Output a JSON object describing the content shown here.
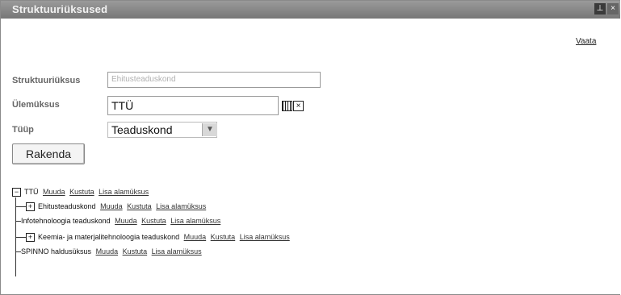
{
  "window": {
    "title": "Struktuuriüksused"
  },
  "top_link": "Vaata",
  "form": {
    "unit_label": "Struktuuriüksus",
    "unit_value": "Ehitusteaduskond",
    "parent_label": "Ülemüksus",
    "parent_value": "TTÜ",
    "type_label": "Tüüp",
    "type_value": "Teaduskond",
    "apply_label": "Rakenda"
  },
  "tree": {
    "root": {
      "label": "TTÜ",
      "actions": [
        "Muuda",
        "Kustuta",
        "Lisa alamüksus"
      ]
    },
    "children": [
      {
        "label": "Ehitusteaduskond",
        "expandable": true,
        "actions": [
          "Muuda",
          "Kustuta",
          "Lisa alamüksus"
        ]
      },
      {
        "label": "Infotehnoloogia teaduskond",
        "expandable": false,
        "actions": [
          "Muuda",
          "Kustuta",
          "Lisa alamüksus"
        ]
      },
      {
        "label": "Keemia- ja materjalitehnoloogia teaduskond",
        "expandable": true,
        "actions": [
          "Muuda",
          "Kustuta",
          "Lisa alamüksus"
        ]
      },
      {
        "label": "SPINNO haldusüksus",
        "expandable": false,
        "actions": [
          "Muuda",
          "Kustuta",
          "Lisa alamüksus"
        ]
      }
    ]
  },
  "icons": {
    "collapse": "minus-box-icon",
    "expand": "plus-box-icon",
    "lookup_grid": "lookup-grid-icon",
    "clear": "clear-x-icon",
    "dropdown": "chevron-down-icon"
  }
}
